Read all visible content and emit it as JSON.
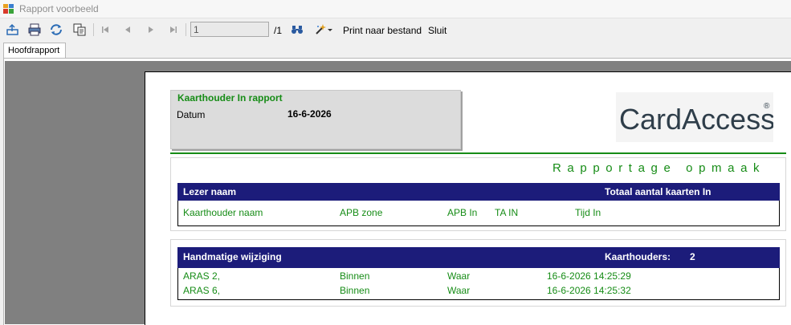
{
  "window": {
    "title": "Rapport voorbeeld"
  },
  "toolbar": {
    "page_value": "1",
    "page_total": "/1",
    "print_to_file_label": "Print naar bestand",
    "close_label": "Sluit"
  },
  "tabs": [
    {
      "label": "Hoofdrapport"
    }
  ],
  "report": {
    "header": {
      "title": "Kaarthouder In rapport",
      "datum_label": "Datum",
      "datum_value": "16-6-2026"
    },
    "logo_text": "CardAccess",
    "logo_mark": "®",
    "section_title": "Rapportage opmaak",
    "group1": {
      "left": "Lezer naam",
      "right": "Totaal aantal kaarten In",
      "columns": [
        "Kaarthouder naam",
        "APB zone",
        "APB In",
        "TA IN",
        "Tijd In"
      ]
    },
    "group2": {
      "left": "Handmatige wijziging",
      "count_label": "Kaarthouders:",
      "count_value": "2",
      "rows": [
        {
          "name": "ARAS 2,",
          "zone": "Binnen",
          "apb_in": "Waar",
          "time": "16-6-2026 14:25:29"
        },
        {
          "name": "ARAS 6,",
          "zone": "Binnen",
          "apb_in": "Waar",
          "time": "16-6-2026 14:25:32"
        }
      ]
    }
  },
  "colors": {
    "accent_green": "#168c16",
    "header_bar": "#1c1c7a",
    "viewer_background": "#808080"
  },
  "icons": [
    "app-icon",
    "export-icon",
    "print-icon",
    "refresh-icon",
    "copy-icon",
    "first-page-icon",
    "previous-page-icon",
    "next-page-icon",
    "last-page-icon",
    "binoculars-icon",
    "zoom-wand-icon",
    "dropdown-arrow-icon"
  ]
}
